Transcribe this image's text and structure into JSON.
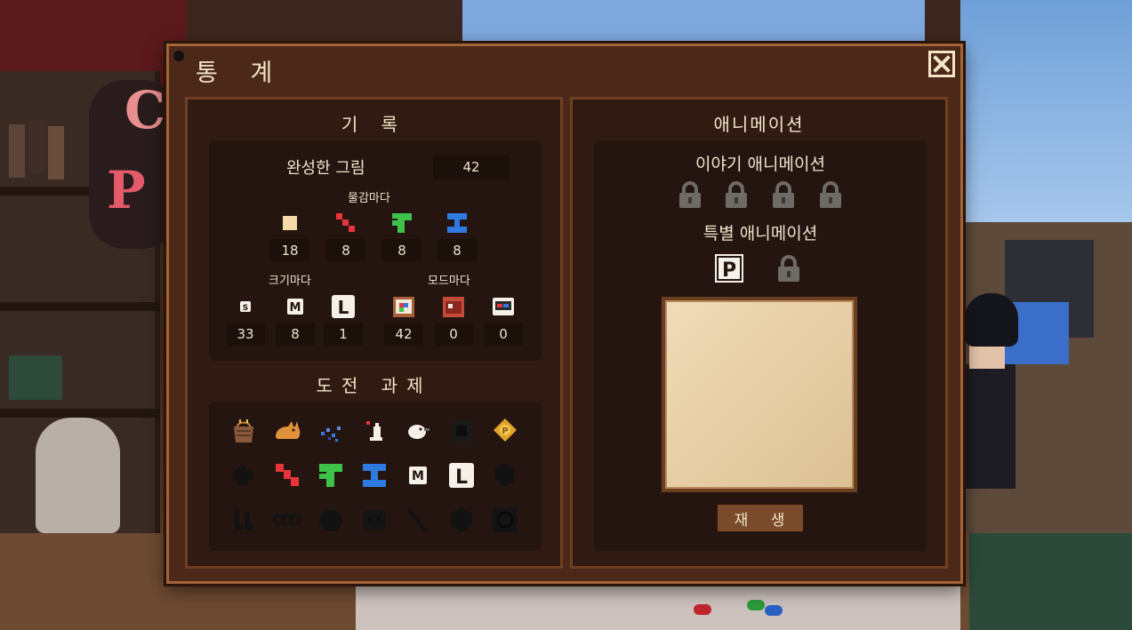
{
  "dialog": {
    "title": "통 계",
    "close_label": "×"
  },
  "record": {
    "heading": "기 록",
    "completed_label": "완성한 그림",
    "completed_value": "42",
    "per_piece_label": "물감마다",
    "per_piece": [
      {
        "icon": "square-piece-icon",
        "value": "18",
        "color": "#f5d9a6"
      },
      {
        "icon": "red-diagonal-piece-icon",
        "value": "8",
        "color": "#e8343a"
      },
      {
        "icon": "green-tetromino-icon",
        "value": "8",
        "color": "#3ec24a"
      },
      {
        "icon": "blue-z-piece-icon",
        "value": "8",
        "color": "#2f7ae0"
      }
    ],
    "per_size_label": "크기마다",
    "per_size": [
      {
        "icon": "small-size-icon",
        "glyph": "S",
        "value": "33"
      },
      {
        "icon": "medium-size-icon",
        "glyph": "M",
        "value": "8"
      },
      {
        "icon": "large-size-icon",
        "glyph": "L",
        "value": "1"
      }
    ],
    "per_mode_label": "모드마다",
    "per_mode": [
      {
        "icon": "easel-mode-icon",
        "value": "42"
      },
      {
        "icon": "red-board-mode-icon",
        "value": "0"
      },
      {
        "icon": "screen-mode-icon",
        "value": "0"
      }
    ]
  },
  "achievements": {
    "heading": "도전 과제",
    "rows": [
      [
        "basket-achievement-icon",
        "cat-achievement-icon",
        "paint-splatter-achievement-icon",
        "figure-achievement-icon",
        "white-bird-achievement-icon",
        "locked-box-achievement-icon",
        "gold-badge-achievement-icon"
      ],
      [
        "locked-blob-achievement-icon",
        "red-piece-achievement-icon",
        "green-piece-achievement-icon",
        "blue-piece-achievement-icon",
        "medium-size-achievement-icon",
        "large-size-achievement-icon",
        "locked-shape-achievement-icon"
      ],
      [
        "locked-boots-achievement-icon",
        "locked-chain-achievement-icon",
        "locked-stone-achievement-icon",
        "locked-eyes-achievement-icon",
        "locked-brush-achievement-icon",
        "locked-hexagon-achievement-icon",
        "locked-swirl-achievement-icon"
      ]
    ]
  },
  "animation": {
    "heading": "애니메이션",
    "story_label": "이야기 애니메이션",
    "story_locks": [
      "lock-icon",
      "lock-icon",
      "lock-icon",
      "lock-icon"
    ],
    "special_label": "특별 애니메이션",
    "special_badge": "P",
    "play_label": "재 생"
  },
  "colors": {
    "dialog_bg": "#4b2818",
    "panel_bg": "#2f1b12",
    "frame": "#a56437",
    "text": "#f3e4c8"
  }
}
